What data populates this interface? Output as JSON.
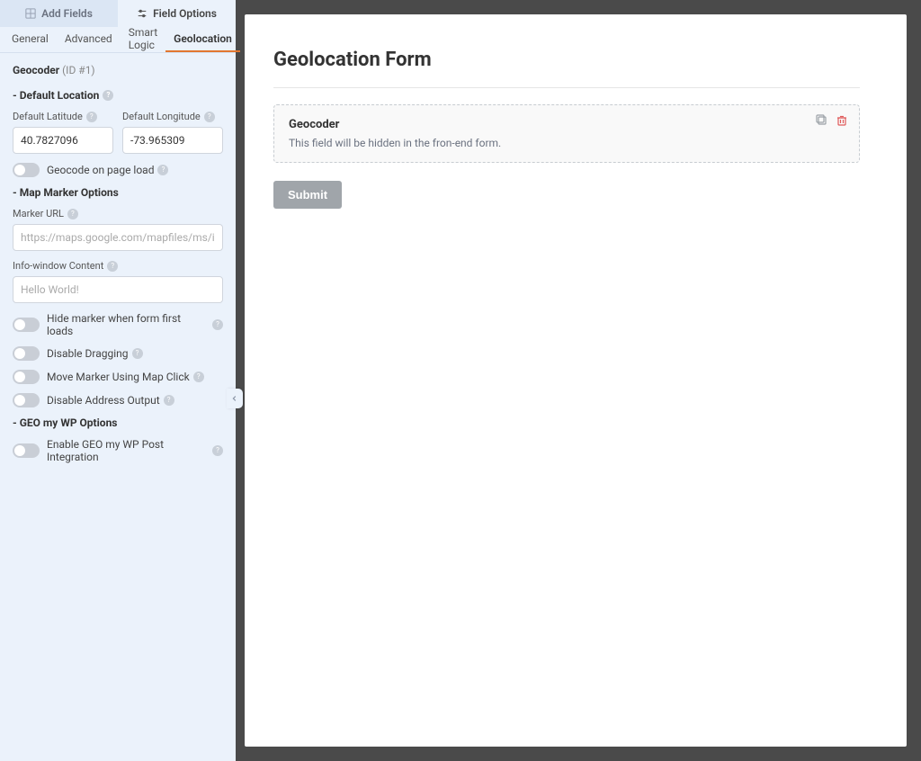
{
  "top_tabs": {
    "add_fields": "Add Fields",
    "field_options": "Field Options"
  },
  "sub_tabs": {
    "general": "General",
    "advanced": "Advanced",
    "smart_logic": "Smart Logic",
    "geolocation": "Geolocation"
  },
  "field_header": {
    "name": "Geocoder",
    "id": "(ID #1)"
  },
  "sections": {
    "default_location": "- Default Location",
    "map_marker_options": "- Map Marker Options",
    "geo_my_wp_options": "- GEO my WP Options"
  },
  "labels": {
    "default_latitude": "Default Latitude",
    "default_longitude": "Default Longitude",
    "marker_url": "Marker URL",
    "info_window_content": "Info-window Content"
  },
  "values": {
    "default_latitude": "40.7827096",
    "default_longitude": "-73.965309"
  },
  "placeholders": {
    "marker_url": "https://maps.google.com/mapfiles/ms/icons/blue.png",
    "info_window_content": "Hello World!"
  },
  "toggles": {
    "geocode_on_page_load": "Geocode on page load",
    "hide_marker": "Hide marker when form first loads",
    "disable_dragging": "Disable Dragging",
    "move_marker_click": "Move Marker Using Map Click",
    "disable_address_output": "Disable Address Output",
    "enable_geo_my_wp": "Enable GEO my WP Post Integration"
  },
  "preview": {
    "form_title": "Geolocation Form",
    "field_title": "Geocoder",
    "field_desc": "This field will be hidden in the fron-end form.",
    "submit_label": "Submit"
  }
}
